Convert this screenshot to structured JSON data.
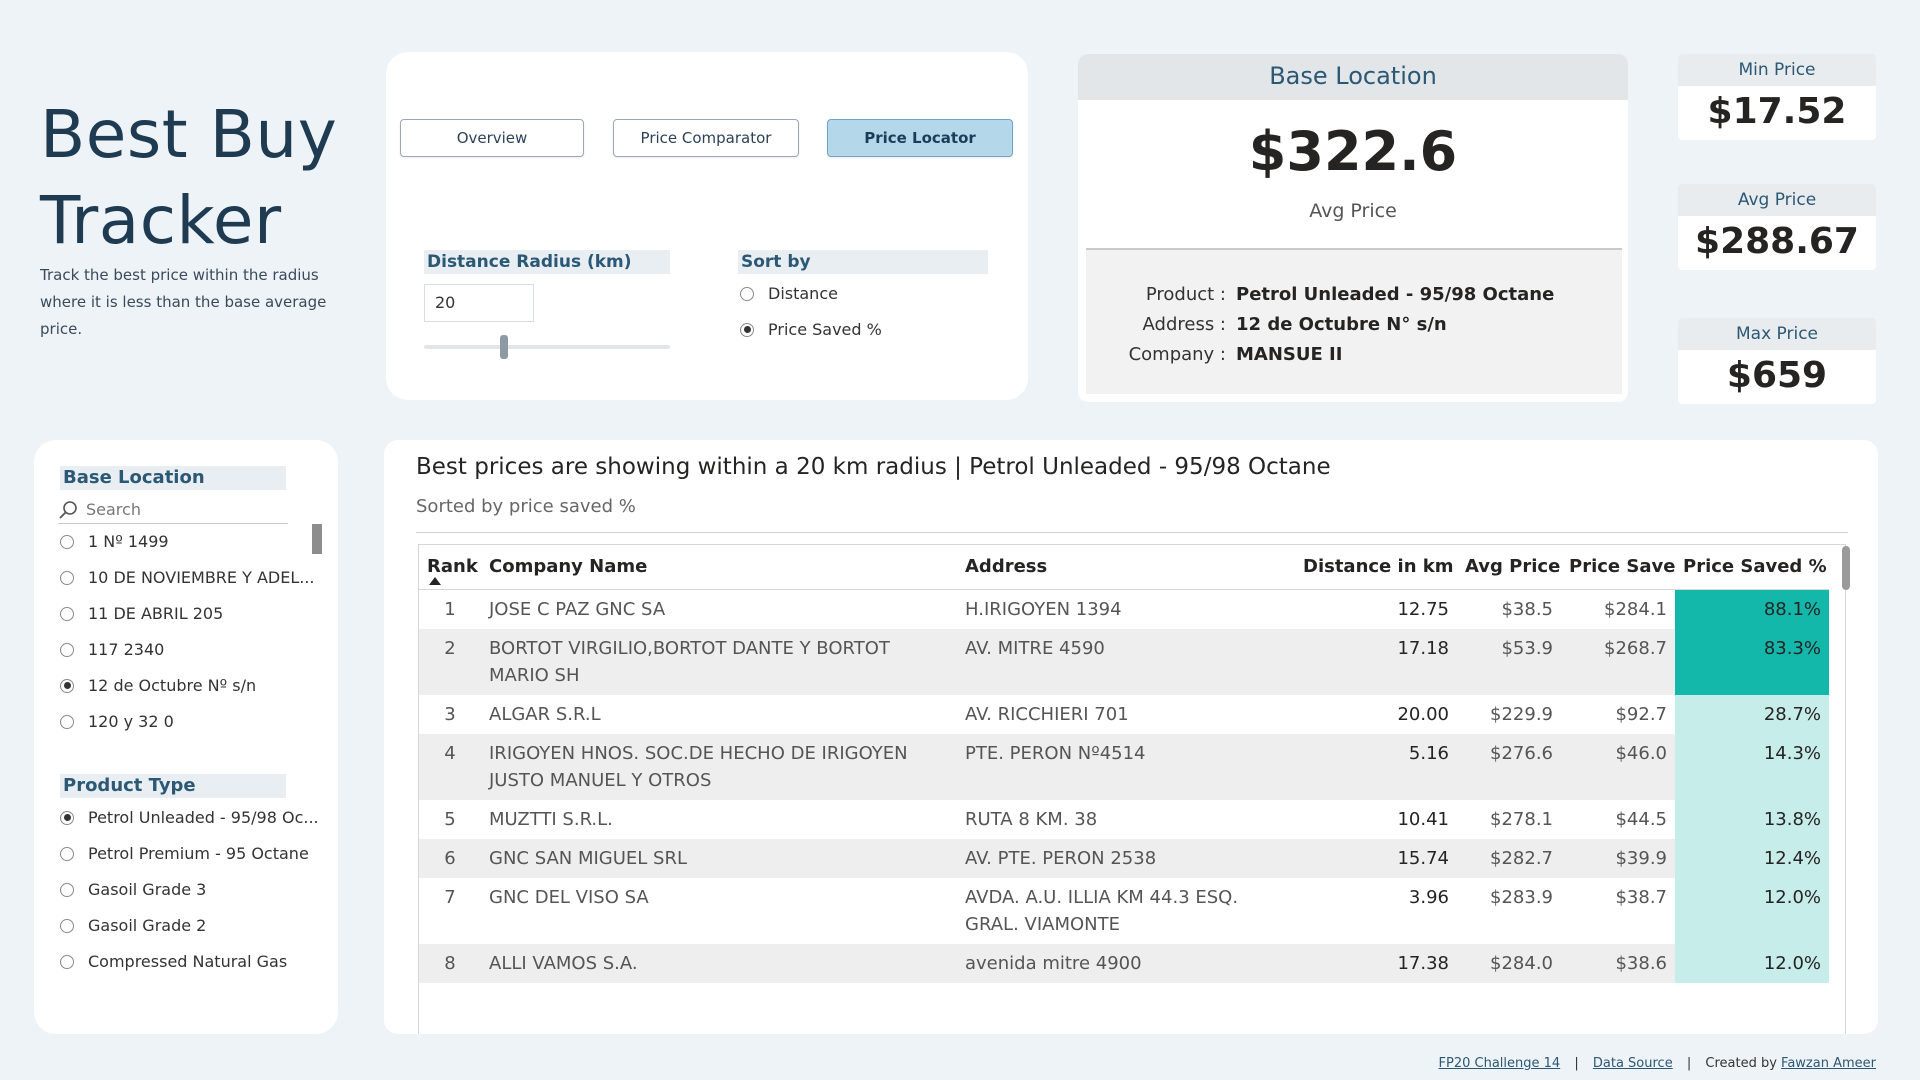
{
  "header": {
    "title_line1": "Best Buy",
    "title_line2": "Tracker",
    "subtitle": "Track the best price within the radius where it is less than the base average price."
  },
  "nav": {
    "buttons": [
      {
        "label": "Overview",
        "active": false
      },
      {
        "label": "Price Comparator",
        "active": false
      },
      {
        "label": "Price Locator",
        "active": true
      }
    ]
  },
  "controls": {
    "distance_label": "Distance Radius (km)",
    "distance_value": "20",
    "sort_label": "Sort by",
    "sort_options": [
      {
        "label": "Distance",
        "selected": false
      },
      {
        "label": "Price Saved %",
        "selected": true
      }
    ]
  },
  "base": {
    "heading": "Base Location",
    "avg_price": "$322.6",
    "avg_label": "Avg Price",
    "product_key": "Product :",
    "product_val": "Petrol Unleaded - 95/98 Octane",
    "address_key": "Address :",
    "address_val": "12 de Octubre N° s/n",
    "company_key": "Company :",
    "company_val": "MANSUE II"
  },
  "kpis": {
    "min": {
      "label": "Min Price",
      "value": "$17.52"
    },
    "avg": {
      "label": "Avg Price",
      "value": "$288.67"
    },
    "max": {
      "label": "Max Price",
      "value": "$659"
    }
  },
  "filters": {
    "base_label": "Base Location",
    "search_placeholder": "Search",
    "locations": [
      {
        "label": "1 Nº 1499",
        "selected": false
      },
      {
        "label": "10 DE NOVIEMBRE Y ADEL...",
        "selected": false
      },
      {
        "label": "11 DE ABRIL 205",
        "selected": false
      },
      {
        "label": "117 2340",
        "selected": false
      },
      {
        "label": "12 de Octubre Nº s/n",
        "selected": true
      },
      {
        "label": "120 y 32 0",
        "selected": false
      }
    ],
    "product_label": "Product Type",
    "products": [
      {
        "label": "Petrol Unleaded - 95/98 Oc...",
        "selected": true
      },
      {
        "label": "Petrol Premium - 95 Octane",
        "selected": false
      },
      {
        "label": "Gasoil Grade 3",
        "selected": false
      },
      {
        "label": "Gasoil Grade 2",
        "selected": false
      },
      {
        "label": "Compressed Natural Gas",
        "selected": false
      }
    ]
  },
  "table": {
    "title": "Best prices are showing within a 20 km radius | Petrol Unleaded - 95/98 Octane",
    "subtitle": "Sorted by price saved %",
    "columns": [
      "Rank",
      "Company Name",
      "Address",
      "Distance in km",
      "Avg Price",
      "Price Save",
      "Price Saved %"
    ],
    "rows": [
      {
        "rank": "1",
        "company": "JOSE C PAZ GNC SA",
        "address": "H.IRIGOYEN 1394",
        "distance": "12.75",
        "avg": "$38.5",
        "save": "$284.1",
        "pct": "88.1%",
        "pct_value": 88.1
      },
      {
        "rank": "2",
        "company": "BORTOT VIRGILIO,BORTOT DANTE Y BORTOT MARIO SH",
        "address": "AV. MITRE 4590",
        "distance": "17.18",
        "avg": "$53.9",
        "save": "$268.7",
        "pct": "83.3%",
        "pct_value": 83.3
      },
      {
        "rank": "3",
        "company": "ALGAR S.R.L",
        "address": "AV. RICCHIERI 701",
        "distance": "20.00",
        "avg": "$229.9",
        "save": "$92.7",
        "pct": "28.7%",
        "pct_value": 28.7
      },
      {
        "rank": "4",
        "company": "IRIGOYEN HNOS. SOC.DE HECHO DE IRIGOYEN JUSTO MANUEL Y OTROS",
        "address": "PTE. PERON Nº4514",
        "distance": "5.16",
        "avg": "$276.6",
        "save": "$46.0",
        "pct": "14.3%",
        "pct_value": 14.3
      },
      {
        "rank": "5",
        "company": "MUZTTI S.R.L.",
        "address": "RUTA 8 KM. 38",
        "distance": "10.41",
        "avg": "$278.1",
        "save": "$44.5",
        "pct": "13.8%",
        "pct_value": 13.8
      },
      {
        "rank": "6",
        "company": "GNC SAN MIGUEL SRL",
        "address": "AV. PTE. PERON 2538",
        "distance": "15.74",
        "avg": "$282.7",
        "save": "$39.9",
        "pct": "12.4%",
        "pct_value": 12.4
      },
      {
        "rank": "7",
        "company": "GNC DEL VISO SA",
        "address": "AVDA. A.U. ILLIA KM 44.3 ESQ. GRAL. VIAMONTE",
        "distance": "3.96",
        "avg": "$283.9",
        "save": "$38.7",
        "pct": "12.0%",
        "pct_value": 12.0
      },
      {
        "rank": "8",
        "company": "ALLI VAMOS S.A.",
        "address": "avenida mitre 4900",
        "distance": "17.38",
        "avg": "$284.0",
        "save": "$38.6",
        "pct": "12.0%",
        "pct_value": 12.0
      }
    ]
  },
  "footer": {
    "challenge": "FP20 Challenge 14",
    "source": "Data Source",
    "created_prefix": "Created by",
    "author": "Fawzan Ameer"
  },
  "colors": {
    "teal_strong": "#14b8aa",
    "teal_light": "#c6ede9",
    "accent_blue": "#2b5874"
  }
}
